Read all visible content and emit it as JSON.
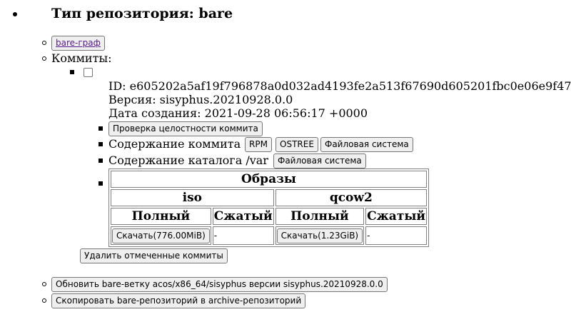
{
  "repo": {
    "title": "Тип репозитория: bare"
  },
  "links": {
    "bare_graph": "bare-граф"
  },
  "commits": {
    "label": "Коммиты:",
    "item": {
      "id_line": "ID: e605202a5af19f796878a0d032ad4193fe2a513f67690d605201fbc0e06e9f47",
      "version_line": "Версия: sisyphus.20210928.0.0",
      "created_line": "Дата создания: 2021-09-28 06:56:17 +0000",
      "integrity_button": "Проверка целостности коммита",
      "content_label": "Содержание коммита",
      "content_buttons": [
        "RPM",
        "OSTREE",
        "Файловая система"
      ],
      "var_label": "Содержание каталога /var",
      "var_button": "Файловая система",
      "images": {
        "title": "Образы",
        "groups": [
          "iso",
          "qcow2"
        ],
        "columns": [
          "Полный",
          "Сжатый",
          "Полный",
          "Сжатый"
        ],
        "iso_full_download": "Скачать(776.00MiB)",
        "iso_compressed": "-",
        "qcow2_full_download": "Скачать(1.23GiB)",
        "qcow2_compressed": "-"
      }
    },
    "delete_button": "Удалить отмеченные коммиты"
  },
  "actions": {
    "update_button": "Обновить bare-ветку acos/x86_64/sisyphus версии sisyphus.20210928.0.0",
    "copy_button": "Скопировать bare-репозиторий в archive-репозиторий"
  }
}
